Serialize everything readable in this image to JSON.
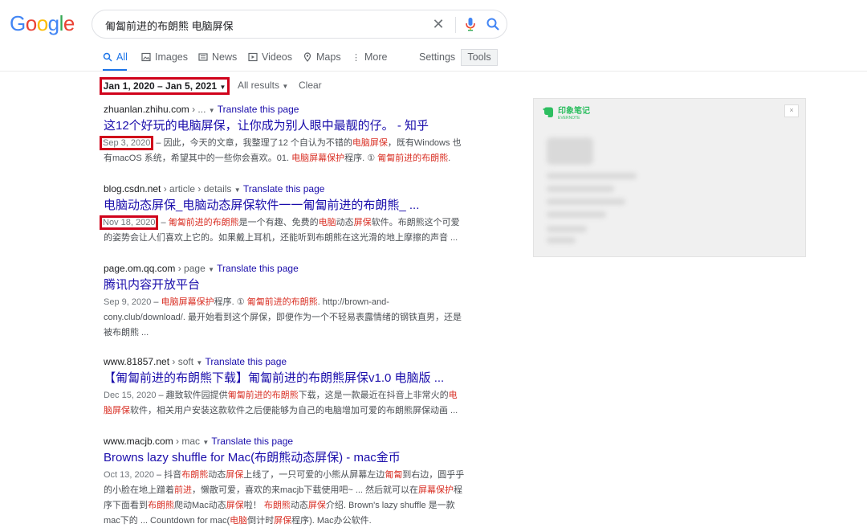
{
  "logo": {
    "text": "Google"
  },
  "search": {
    "query": "匍匐前进的布朗熊 电脑屏保"
  },
  "tabs": [
    {
      "label": "All",
      "icon": "search-icon"
    },
    {
      "label": "Images",
      "icon": "image-icon"
    },
    {
      "label": "News",
      "icon": "news-icon"
    },
    {
      "label": "Videos",
      "icon": "video-icon"
    },
    {
      "label": "Maps",
      "icon": "map-pin-icon"
    },
    {
      "label": "More",
      "icon": "more-icon"
    }
  ],
  "settings_label": "Settings",
  "tools_label": "Tools",
  "filters": {
    "date_range": "Jan 1, 2020 – Jan 5, 2021",
    "all_results": "All results",
    "clear": "Clear"
  },
  "translate_label": "Translate this page",
  "results": [
    {
      "site": "zhuanlan.zhihu.com",
      "path": " › ...",
      "title": "这12个好玩的电脑屏保，让你成为别人眼中最靓的仔。 - 知乎",
      "date": "Sep 3, 2020",
      "snippet": [
        {
          "t": " – 因此，今天的文章，我整理了12 个自认为不错的"
        },
        {
          "t": "电脑屏保",
          "em": true
        },
        {
          "t": "，既有Windows 也有macOS 系统，希望其中的一些你会喜欢。01. "
        },
        {
          "t": "电脑屏幕保护",
          "em": true
        },
        {
          "t": "程序. ① "
        },
        {
          "t": "匍匐前进的布朗熊",
          "em": true
        },
        {
          "t": "."
        }
      ]
    },
    {
      "site": "blog.csdn.net",
      "path": " › article › details",
      "title": "电脑动态屏保_电脑动态屏保软件一一匍匐前进的布朗熊_ ...",
      "date": "Nov 18, 2020",
      "snippet": [
        {
          "t": " – "
        },
        {
          "t": "匍匐前进的布朗熊",
          "em": true
        },
        {
          "t": "是一个有趣、免费的"
        },
        {
          "t": "电脑",
          "em": true
        },
        {
          "t": "动态"
        },
        {
          "t": "屏保",
          "em": true
        },
        {
          "t": "软件。布朗熊这个可爱的姿势会让人们喜欢上它的。如果戴上耳机，还能听到布朗熊在这光滑的地上摩擦的声音 ..."
        }
      ]
    },
    {
      "site": "page.om.qq.com",
      "path": " › page",
      "title": "腾讯内容开放平台",
      "date": "Sep 9, 2020",
      "snippet": [
        {
          "t": " – "
        },
        {
          "t": "电脑屏幕保护",
          "em": true
        },
        {
          "t": "程序. ① "
        },
        {
          "t": "匍匐前进的布朗熊",
          "em": true
        },
        {
          "t": ". http://brown-and-cony.club/download/. 最开始看到这个屏保，即便作为一个不轻易表露情绪的钢铁直男，还是被布朗熊 ..."
        }
      ]
    },
    {
      "site": "www.81857.net",
      "path": " › soft",
      "title": "【匍匐前进的布朗熊下载】匍匐前进的布朗熊屏保v1.0 电脑版 ...",
      "date": "Dec 15, 2020",
      "snippet": [
        {
          "t": " – 趣致软件园提供"
        },
        {
          "t": "匍匐前进的布朗熊",
          "em": true
        },
        {
          "t": "下载，这是一款最近在抖音上非常火的"
        },
        {
          "t": "电脑屏保",
          "em": true
        },
        {
          "t": "软件，相关用户安装这款软件之后便能够为自己的电脑增加可爱的布朗熊屏保动画 ..."
        }
      ]
    },
    {
      "site": "www.macjb.com",
      "path": " › mac",
      "title": "Browns lazy shuffle for Mac(布朗熊动态屏保) - mac金币",
      "date": "Oct 13, 2020",
      "snippet": [
        {
          "t": " – 抖音"
        },
        {
          "t": "布朗熊",
          "em": true
        },
        {
          "t": "动态"
        },
        {
          "t": "屏保",
          "em": true
        },
        {
          "t": "上线了，一只可爱的小熊从屏幕左边"
        },
        {
          "t": "匍匐",
          "em": true
        },
        {
          "t": "到右边，圆乎乎的小脸在地上蹭着"
        },
        {
          "t": "前进",
          "em": true
        },
        {
          "t": "，懒散可爱，喜欢的来macjb下载使用吧~ ... 然后就可以在"
        },
        {
          "t": "屏幕保护",
          "em": true
        },
        {
          "t": "程序下面看到"
        },
        {
          "t": "布朗熊",
          "em": true
        },
        {
          "t": "爬动Mac动态"
        },
        {
          "t": "屏保",
          "em": true
        },
        {
          "t": "啦！ "
        },
        {
          "t": "布朗熊",
          "em": true
        },
        {
          "t": "动态"
        },
        {
          "t": "屏保",
          "em": true
        },
        {
          "t": "介绍. Brown's lazy shuffle 是一款mac下的 ... Countdown for mac("
        },
        {
          "t": "电脑",
          "em": true
        },
        {
          "t": "倒计时"
        },
        {
          "t": "屏保",
          "em": true
        },
        {
          "t": "程序). Mac办公软件."
        }
      ]
    }
  ],
  "ad": {
    "brand": "印象笔记",
    "sub": "EVERNOTE",
    "close": "×"
  },
  "colors": {
    "link": "#1a0dab",
    "accent": "#1a73e8",
    "highlight_box": "#d0021b",
    "em": "#d93025"
  }
}
